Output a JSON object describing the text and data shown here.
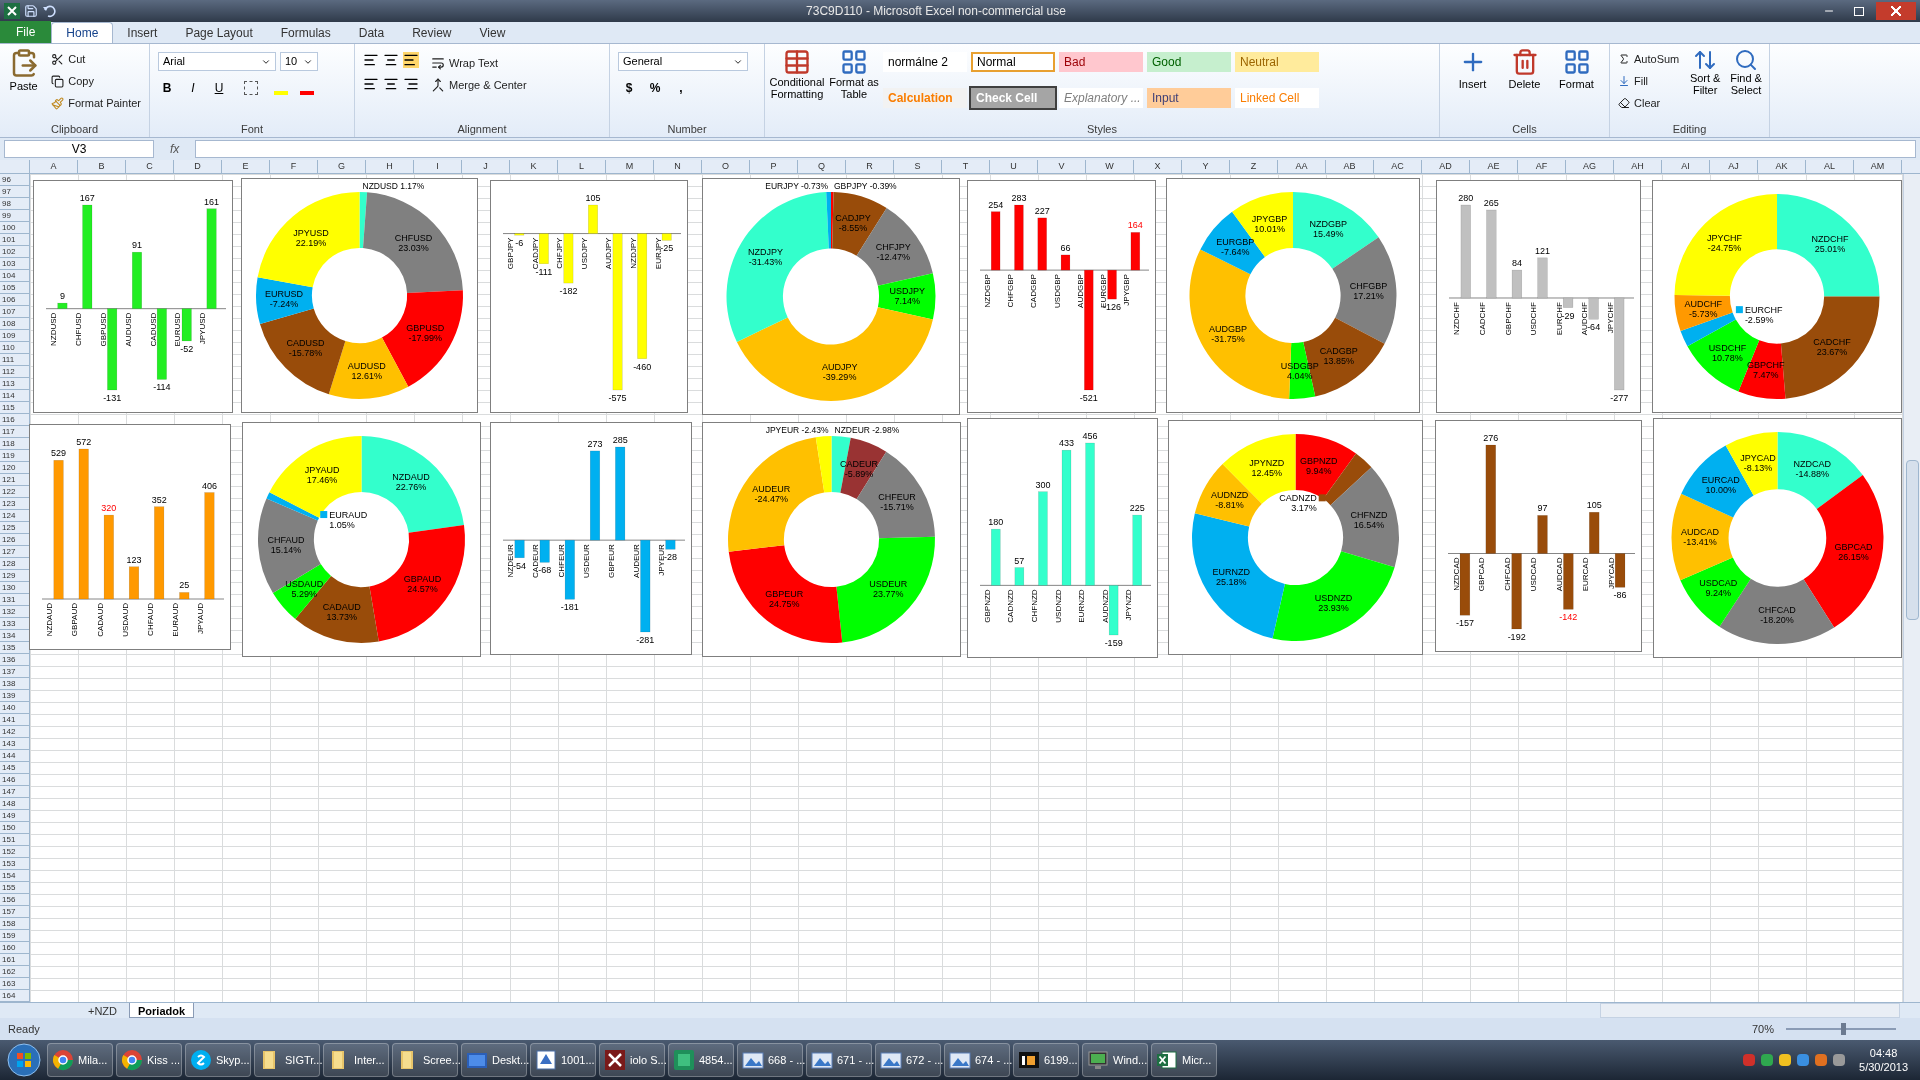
{
  "window": {
    "title": "73C9D110 - Microsoft Excel non-commercial use"
  },
  "tabs": [
    {
      "label": "File",
      "selected": false,
      "kind": "file"
    },
    {
      "label": "Home",
      "selected": true,
      "kind": "tab"
    },
    {
      "label": "Insert",
      "selected": false,
      "kind": "tab"
    },
    {
      "label": "Page Layout",
      "selected": false,
      "kind": "tab"
    },
    {
      "label": "Formulas",
      "selected": false,
      "kind": "tab"
    },
    {
      "label": "Data",
      "selected": false,
      "kind": "tab"
    },
    {
      "label": "Review",
      "selected": false,
      "kind": "tab"
    },
    {
      "label": "View",
      "selected": false,
      "kind": "tab"
    }
  ],
  "clipboard": {
    "label": "Clipboard",
    "paste": "Paste",
    "cut": "Cut",
    "copy": "Copy",
    "format_painter": "Format Painter"
  },
  "font": {
    "label": "Font",
    "family": "Arial",
    "size": "10",
    "buttons": [
      "B",
      "I",
      "U"
    ]
  },
  "alignment": {
    "label": "Alignment",
    "wrap_text": "Wrap Text",
    "merge_center": "Merge & Center"
  },
  "number": {
    "label": "Number",
    "format": "General",
    "symbols": [
      "$",
      "%",
      ","
    ]
  },
  "styles": {
    "label": "Styles",
    "conditional": "Conditional Formatting",
    "format_table": "Format as Table",
    "cells": [
      {
        "text": "normálne 2",
        "kind": "plain",
        "selected": false
      },
      {
        "text": "Normal",
        "kind": "plain",
        "selected": true
      },
      {
        "text": "Bad",
        "kind": "bad",
        "selected": false
      },
      {
        "text": "Good",
        "kind": "good",
        "selected": false
      },
      {
        "text": "Neutral",
        "kind": "neutral",
        "selected": false
      },
      {
        "text": "Calculation",
        "kind": "calculation",
        "selected": false
      },
      {
        "text": "Check Cell",
        "kind": "check",
        "selected": false
      },
      {
        "text": "Explanatory ...",
        "kind": "explanatory",
        "selected": false
      },
      {
        "text": "Input",
        "kind": "input",
        "selected": false
      },
      {
        "text": "Linked Cell",
        "kind": "linked",
        "selected": false
      }
    ]
  },
  "cells": {
    "label": "Cells",
    "buttons": [
      "Insert",
      "Delete",
      "Format"
    ]
  },
  "editing": {
    "label": "Editing",
    "autosum": "AutoSum",
    "fill": "Fill",
    "clear": "Clear",
    "sort": "Sort & Filter",
    "find": "Find & Select"
  },
  "formula_bar": {
    "name_box": "V3",
    "fx": "fx"
  },
  "columns": [
    "A",
    "B",
    "C",
    "D",
    "E",
    "F",
    "G",
    "H",
    "I",
    "J",
    "K",
    "L",
    "M",
    "N",
    "O",
    "P",
    "Q",
    "R",
    "S",
    "T",
    "U",
    "V",
    "W",
    "X",
    "Y",
    "Z",
    "AA",
    "AB",
    "AC",
    "AD",
    "AE",
    "AF",
    "AG",
    "AH",
    "AI",
    "AJ",
    "AK",
    "AL",
    "AM"
  ],
  "rows": [
    "96",
    "97",
    "98",
    "99",
    "100",
    "101",
    "102",
    "103",
    "104",
    "105",
    "106",
    "107",
    "108",
    "109",
    "110",
    "111",
    "112",
    "113",
    "114",
    "115",
    "116",
    "117",
    "118",
    "119",
    "120",
    "121",
    "122",
    "123",
    "124",
    "125",
    "126",
    "127",
    "128",
    "129",
    "130",
    "131",
    "132",
    "133",
    "134",
    "135",
    "136",
    "137",
    "138",
    "139",
    "140",
    "141",
    "142",
    "143",
    "144",
    "145",
    "146",
    "147",
    "148",
    "149",
    "150",
    "151",
    "152",
    "153",
    "154",
    "155",
    "156",
    "157",
    "158",
    "159",
    "160",
    "161",
    "162",
    "163",
    "164"
  ],
  "charts": [
    {
      "kind": "bar",
      "red_labels": [
        false,
        false,
        false,
        false,
        false,
        false,
        false
      ],
      "chart_data": {
        "type": "bar",
        "categories": [
          "NZDUSD",
          "CHFUSD",
          "GBPUSD",
          "AUDUSD",
          "CADUSD",
          "EURUSD",
          "JPYUSD"
        ],
        "series": [
          {
            "color": "#22ee22",
            "values": [
              9,
              167,
              -131,
              91,
              -114,
              -52,
              161
            ]
          }
        ],
        "data_labels": true
      }
    },
    {
      "kind": "donut",
      "slice_labels": [
        "1.17%",
        "23.03%",
        "-17.99%",
        "12.61%",
        "-15.78%",
        "-7.24%",
        "22.19%"
      ],
      "chart_data": {
        "type": "donut",
        "categories": [
          "NZDUSD",
          "CHFUSD",
          "GBPUSD",
          "AUDUSD",
          "CADUSD",
          "EURUSD",
          "JPYUSD"
        ],
        "values": [
          1.17,
          23.03,
          17.99,
          12.61,
          15.78,
          7.24,
          22.19
        ],
        "colors": [
          "#33ffcc",
          "#808080",
          "#ff0000",
          "#ffc000",
          "#994c0a",
          "#00b0f0",
          "#ffff00"
        ]
      }
    },
    {
      "kind": "bar",
      "red_labels": [
        false,
        false,
        false,
        false,
        false,
        false,
        false
      ],
      "chart_data": {
        "type": "bar",
        "categories": [
          "GBPJPY",
          "CADJPY",
          "CHFJPY",
          "USDJPY",
          "AUDJPY",
          "NZDJPY",
          "EURJPY"
        ],
        "series": [
          {
            "color": "#ffff00",
            "values": [
              -6,
              -111,
              -182,
              105,
              -575,
              -460,
              -25
            ]
          }
        ],
        "data_labels": true
      }
    },
    {
      "kind": "donut",
      "slice_labels": [
        "-0.39%",
        "-8.55%",
        "-12.47%",
        "7.14%",
        "-39.29%",
        "-31.43%",
        "-0.73%"
      ],
      "chart_data": {
        "type": "donut",
        "categories": [
          "GBPJPY",
          "CADJPY",
          "CHFJPY",
          "USDJPY",
          "AUDJPY",
          "NZDJPY",
          "EURJPY"
        ],
        "values": [
          0.39,
          8.55,
          12.47,
          7.14,
          39.29,
          31.43,
          0.73
        ],
        "colors": [
          "#ff0000",
          "#994c0a",
          "#808080",
          "#00ff00",
          "#ffc000",
          "#33ffcc",
          "#00b0f0"
        ]
      }
    },
    {
      "kind": "bar",
      "red_labels": [
        false,
        false,
        false,
        false,
        false,
        false,
        true
      ],
      "chart_data": {
        "type": "bar",
        "categories": [
          "NZDGBP",
          "CHFGBP",
          "CADGBP",
          "USDGBP",
          "AUDGBP",
          "EURGBP",
          "JPYGBP"
        ],
        "series": [
          {
            "color": "#ff0000",
            "values": [
              254,
              283,
              227,
              66,
              -521,
              -126,
              164
            ]
          }
        ],
        "data_labels": true
      }
    },
    {
      "kind": "donut",
      "slice_labels": [
        "15.49%",
        "17.21%",
        "13.85%",
        "4.04%",
        "-31.75%",
        "-7.64%",
        "10.01%"
      ],
      "chart_data": {
        "type": "donut",
        "categories": [
          "NZDGBP",
          "CHFGBP",
          "CADGBP",
          "USDGBP",
          "AUDGBP",
          "EURGBP",
          "JPYGBP"
        ],
        "values": [
          15.49,
          17.21,
          13.85,
          4.04,
          31.75,
          7.64,
          10.01
        ],
        "colors": [
          "#33ffcc",
          "#808080",
          "#994c0a",
          "#00ff00",
          "#ffc000",
          "#00b0f0",
          "#ffff00"
        ]
      }
    },
    {
      "kind": "bar",
      "red_labels": [
        false,
        false,
        false,
        false,
        false,
        false,
        false
      ],
      "chart_data": {
        "type": "bar",
        "categories": [
          "NZDCHF",
          "CADCHF",
          "GBPCHF",
          "USDCHF",
          "EURCHF",
          "AUDCHF",
          "JPYCHF"
        ],
        "series": [
          {
            "color": "#c0c0c0",
            "values": [
              280,
              265,
              84,
              121,
              -29,
              -64,
              -277
            ]
          }
        ],
        "data_labels": true
      }
    },
    {
      "kind": "donut",
      "slice_labels": [
        "25.01%",
        "23.67%",
        "7.47%",
        "10.78%",
        "-2.59%",
        "-5.73%",
        "-24.75%"
      ],
      "chart_data": {
        "type": "donut",
        "categories": [
          "NZDCHF",
          "CADCHF",
          "GBPCHF",
          "USDCHF",
          "EURCHF",
          "AUDCHF",
          "JPYCHF"
        ],
        "values": [
          25.01,
          23.67,
          7.47,
          10.78,
          2.59,
          5.73,
          24.75
        ],
        "colors": [
          "#33ffcc",
          "#994c0a",
          "#ff0000",
          "#00ff00",
          "#00b0f0",
          "#ff9900",
          "#ffff00"
        ]
      }
    },
    {
      "kind": "bar",
      "red_labels": [
        false,
        false,
        true,
        false,
        false,
        false,
        false
      ],
      "chart_data": {
        "type": "bar",
        "categories": [
          "NZDAUD",
          "GBPAUD",
          "CADAUD",
          "USDAUD",
          "CHFAUD",
          "EURAUD",
          "JPYAUD"
        ],
        "series": [
          {
            "color": "#ff9900",
            "values": [
              529,
              572,
              320,
              123,
              352,
              25,
              406
            ]
          }
        ],
        "data_labels": true
      }
    },
    {
      "kind": "donut",
      "slice_labels": [
        "22.76%",
        "24.57%",
        "13.73%",
        "5.29%",
        "15.14%",
        "1.05%",
        "17.46%"
      ],
      "chart_data": {
        "type": "donut",
        "categories": [
          "NZDAUD",
          "GBPAUD",
          "CADAUD",
          "USDAUD",
          "CHFAUD",
          "EURAUD",
          "JPYAUD"
        ],
        "values": [
          22.76,
          24.57,
          13.73,
          5.29,
          15.14,
          1.05,
          17.46
        ],
        "colors": [
          "#33ffcc",
          "#ff0000",
          "#994c0a",
          "#00ff00",
          "#808080",
          "#00b0f0",
          "#ffff00"
        ]
      }
    },
    {
      "kind": "bar",
      "red_labels": [
        false,
        false,
        false,
        false,
        false,
        false,
        false
      ],
      "chart_data": {
        "type": "bar",
        "categories": [
          "NZDEUR",
          "CADEUR",
          "CHFEUR",
          "USDEUR",
          "GBPEUR",
          "AUDEUR",
          "JPYEUR"
        ],
        "series": [
          {
            "color": "#00b0f0",
            "values": [
              -54,
              -68,
              -181,
              273,
              285,
              -281,
              -28
            ]
          }
        ],
        "data_labels": true
      }
    },
    {
      "kind": "donut",
      "slice_labels": [
        "-2.98%",
        "-5.89%",
        "-15.71%",
        "23.77%",
        "24.75%",
        "-24.47%",
        "-2.43%"
      ],
      "chart_data": {
        "type": "donut",
        "categories": [
          "NZDEUR",
          "CADEUR",
          "CHFEUR",
          "USDEUR",
          "GBPEUR",
          "AUDEUR",
          "JPYEUR"
        ],
        "values": [
          2.98,
          5.89,
          15.71,
          23.77,
          24.75,
          24.47,
          2.43
        ],
        "colors": [
          "#33ffcc",
          "#993333",
          "#808080",
          "#00ff00",
          "#ff0000",
          "#ffc000",
          "#ffff00"
        ]
      }
    },
    {
      "kind": "bar",
      "red_labels": [
        false,
        false,
        false,
        false,
        false,
        false,
        false
      ],
      "chart_data": {
        "type": "bar",
        "categories": [
          "GBPNZD",
          "CADNZD",
          "CHFNZD",
          "USDNZD",
          "EURNZD",
          "AUDNZD",
          "JPYNZD"
        ],
        "series": [
          {
            "color": "#33ffcc",
            "values": [
              180,
              57,
              300,
              433,
              456,
              -159,
              225
            ]
          }
        ],
        "data_labels": true
      }
    },
    {
      "kind": "donut",
      "slice_labels": [
        "9.94%",
        "3.17%",
        "16.54%",
        "23.93%",
        "25.18%",
        "-8.81%",
        "12.45%"
      ],
      "chart_data": {
        "type": "donut",
        "categories": [
          "GBPNZD",
          "CADNZD",
          "CHFNZD",
          "USDNZD",
          "EURNZD",
          "AUDNZD",
          "JPYNZD"
        ],
        "values": [
          9.94,
          3.17,
          16.54,
          23.93,
          25.18,
          8.81,
          12.45
        ],
        "colors": [
          "#ff0000",
          "#994c0a",
          "#808080",
          "#00ff00",
          "#00b0f0",
          "#ffc000",
          "#ffff00"
        ]
      }
    },
    {
      "kind": "bar",
      "red_labels": [
        false,
        false,
        false,
        false,
        true,
        false,
        false
      ],
      "chart_data": {
        "type": "bar",
        "categories": [
          "NZDCAD",
          "GBPCAD",
          "CHFCAD",
          "USDCAD",
          "AUDCAD",
          "EURCAD",
          "JPYCAD"
        ],
        "series": [
          {
            "color": "#994c0a",
            "values": [
              -157,
              276,
              -192,
              97,
              -142,
              105,
              -86
            ]
          }
        ],
        "data_labels": true
      }
    },
    {
      "kind": "donut",
      "slice_labels": [
        "-14.88%",
        "26.15%",
        "-18.20%",
        "9.24%",
        "-13.41%",
        "10.00%",
        "-8.13%"
      ],
      "chart_data": {
        "type": "donut",
        "categories": [
          "NZDCAD",
          "GBPCAD",
          "CHFCAD",
          "USDCAD",
          "AUDCAD",
          "EURCAD",
          "JPYCAD"
        ],
        "values": [
          14.88,
          26.15,
          18.2,
          9.24,
          13.41,
          10.0,
          8.13
        ],
        "colors": [
          "#33ffcc",
          "#ff0000",
          "#808080",
          "#00ff00",
          "#ffc000",
          "#00b0f0",
          "#ffff00"
        ]
      }
    }
  ],
  "sheet_tabs": [
    {
      "label": "+NZD",
      "selected": false
    },
    {
      "label": "Poriadok",
      "selected": true
    }
  ],
  "status_bar": {
    "state": "Ready",
    "zoom": "70%",
    "level": 0.5
  },
  "taskbar": {
    "items": [
      {
        "label": "Mila...",
        "kind": "chrome"
      },
      {
        "label": "Kiss ...",
        "kind": "chrome"
      },
      {
        "label": "Skyp...",
        "kind": "skype"
      },
      {
        "label": "SIGTr...",
        "kind": "folder"
      },
      {
        "label": "Inter...",
        "kind": "folder"
      },
      {
        "label": "Scree...",
        "kind": "folder"
      },
      {
        "label": "Deskt...",
        "kind": "window"
      },
      {
        "label": "1001...",
        "kind": "app"
      },
      {
        "label": "iolo S...",
        "kind": "tool"
      },
      {
        "label": "4854...",
        "kind": "green"
      },
      {
        "label": "668 - ...",
        "kind": "image"
      },
      {
        "label": "671 - ...",
        "kind": "image"
      },
      {
        "label": "672 - ...",
        "kind": "image"
      },
      {
        "label": "674 - ...",
        "kind": "image"
      },
      {
        "label": "6199...",
        "kind": "ib"
      },
      {
        "label": "Wind...",
        "kind": "monitor"
      },
      {
        "label": "Micr...",
        "kind": "excel"
      }
    ],
    "time": "04:48",
    "date": "5/30/2013"
  }
}
